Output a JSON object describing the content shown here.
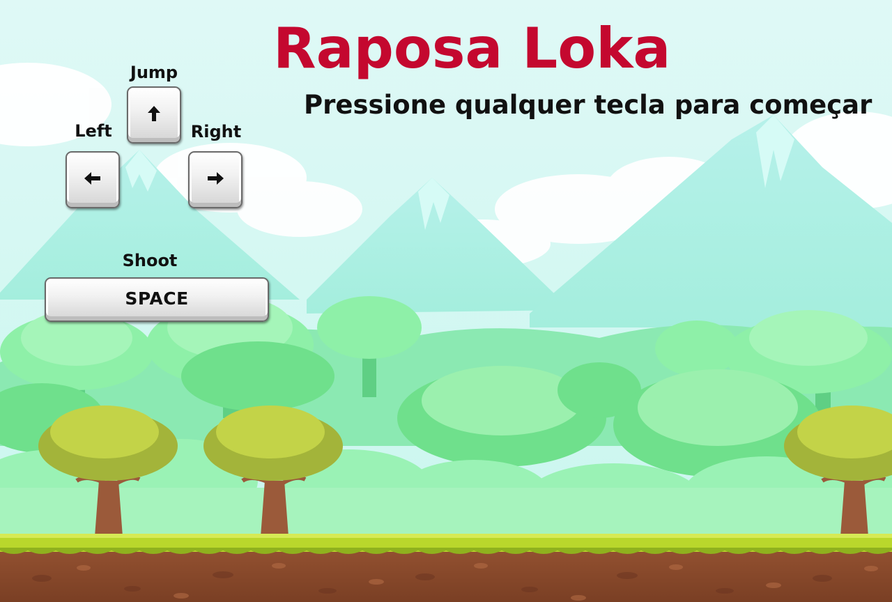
{
  "game": {
    "title": "Raposa Loka",
    "subtitle": "Pressione qualquer tecla para começar"
  },
  "controls": {
    "jump": {
      "label": "Jump",
      "icon": "arrow-up-icon"
    },
    "left": {
      "label": "Left",
      "icon": "arrow-left-icon"
    },
    "right": {
      "label": "Right",
      "icon": "arrow-right-icon"
    },
    "shoot": {
      "label": "Shoot",
      "key": "SPACE"
    }
  },
  "colors": {
    "title": "#c4082f",
    "text": "#111111",
    "sky": "#d9f8f4",
    "grass": "#b9d72c",
    "dirt": "#8a4a2c"
  }
}
